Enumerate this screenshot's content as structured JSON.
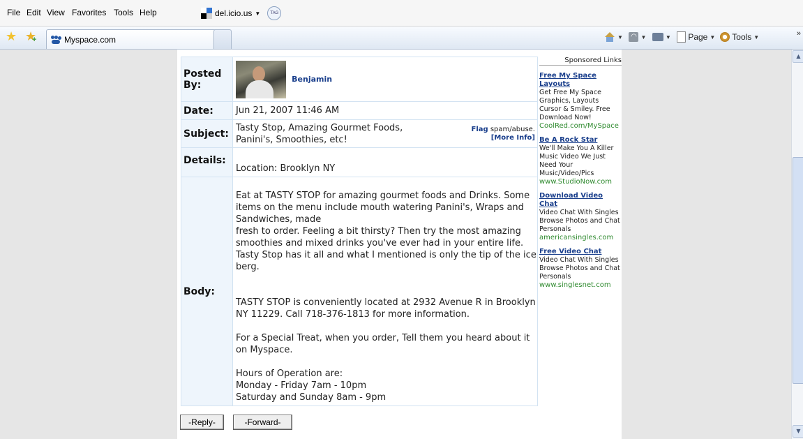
{
  "menubar": {
    "items": [
      "File",
      "Edit",
      "View",
      "Favorites",
      "Tools",
      "Help"
    ],
    "delicious_label": "del.icio.us",
    "tag_label": "TAG"
  },
  "toolbar": {
    "tab_title": "Myspace.com",
    "page_label": "Page",
    "tools_label": "Tools"
  },
  "post": {
    "labels": {
      "posted_by": "Posted By:",
      "date": "Date:",
      "subject": "Subject:",
      "details": "Details:",
      "body": "Body:"
    },
    "poster_name": "Benjamin",
    "date": "Jun 21, 2007 11:46 AM",
    "subject_line1": "Tasty Stop, Amazing Gourmet Foods,",
    "subject_line2": "Panini's, Smoothies, etc!",
    "flag_link": "Flag",
    "flag_suffix": " spam/abuse.",
    "more_info": "[More Info]",
    "details": "Location: Brooklyn NY",
    "body_paragraphs": [
      "Eat at TASTY STOP for amazing gourmet foods and Drinks. Some items on the menu include mouth watering Panini's, Wraps and Sandwiches, made",
      "fresh to order. Feeling a bit thirsty? Then try the most amazing smoothies and mixed drinks you've ever had in your entire life. Tasty Stop has it all and what I mentioned is only the tip of the ice berg.",
      "TASTY STOP is conveniently located at 2932 Avenue R in Brooklyn NY 11229. Call 718-376-1813 for more information.",
      "For a Special Treat, when you order, Tell them you heard about it on Myspace.",
      "Hours of Operation are:",
      "Monday - Friday 7am - 10pm",
      "Saturday and Sunday 8am - 9pm"
    ]
  },
  "buttons": {
    "reply": "-Reply-",
    "forward": "-Forward-"
  },
  "sponsored": {
    "heading": "Sponsored Links",
    "ads": [
      {
        "title": "Free My Space Layouts",
        "desc": "Get Free My Space Graphics, Layouts Cursor & Smiley. Free Download Now!",
        "url": "CoolRed.com/MySpace"
      },
      {
        "title": "Be A Rock Star",
        "desc": "We'll Make You A Killer Music Video We Just Need Your Music/Video/Pics",
        "url": "www.StudioNow.com"
      },
      {
        "title": "Download Video Chat",
        "desc": "Video Chat With Singles Browse Photos and Chat Personals",
        "url": "americansingles.com"
      },
      {
        "title": "Free Video Chat",
        "desc": "Video Chat With Singles Browse Photos and Chat Personals",
        "url": "www.singlesnet.com"
      }
    ]
  },
  "colors": {
    "label_bg": "#eef5fc",
    "link": "#1a3f8c",
    "ad_url": "#2f8a2f",
    "page_bg": "#e6e6e6"
  }
}
